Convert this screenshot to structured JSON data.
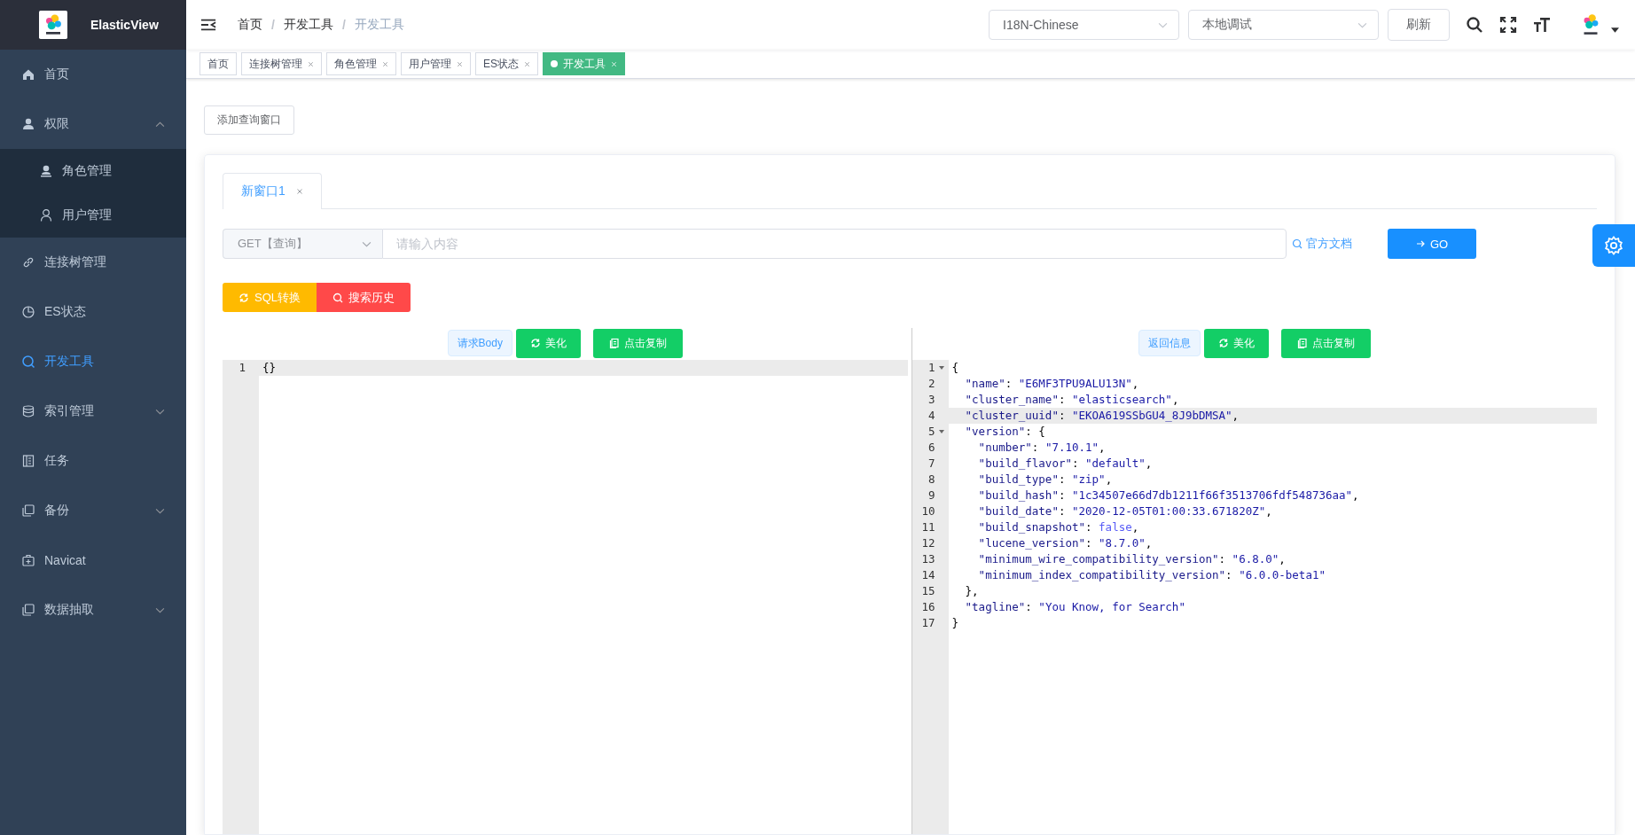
{
  "app": {
    "title": "ElasticView"
  },
  "sidebar": {
    "items": [
      {
        "label": "首页",
        "selected": false
      },
      {
        "label": "权限",
        "selected": false,
        "expanded": true,
        "children": [
          {
            "label": "角色管理",
            "selected": false
          },
          {
            "label": "用户管理",
            "selected": false
          }
        ]
      },
      {
        "label": "连接树管理",
        "selected": false
      },
      {
        "label": "ES状态",
        "selected": false
      },
      {
        "label": "开发工具",
        "selected": true
      },
      {
        "label": "索引管理",
        "selected": false,
        "expanded": false
      },
      {
        "label": "任务",
        "selected": false
      },
      {
        "label": "备份",
        "selected": false,
        "expanded": false
      },
      {
        "label": "Navicat",
        "selected": false
      },
      {
        "label": "数据抽取",
        "selected": false,
        "expanded": false
      }
    ]
  },
  "breadcrumb": [
    {
      "label": "首页"
    },
    {
      "separator": "/",
      "label": "开发工具"
    },
    {
      "separator": "/",
      "label": "开发工具"
    }
  ],
  "header": {
    "language": "I18N-Chinese",
    "connection": "本地调试",
    "refresh_button": "刷新"
  },
  "tags": [
    {
      "label": "首页",
      "selected": false,
      "closable": false
    },
    {
      "label": "连接树管理",
      "selected": false,
      "closable": true
    },
    {
      "label": "角色管理",
      "selected": false,
      "closable": true
    },
    {
      "label": "用户管理",
      "selected": false,
      "closable": true
    },
    {
      "label": "ES状态",
      "selected": false,
      "closable": true
    },
    {
      "label": "开发工具",
      "selected": true,
      "closable": true
    }
  ],
  "add_window_button": "添加查询窗口",
  "query_tabs": [
    {
      "label": "新窗口1",
      "selected": true
    }
  ],
  "query": {
    "method": "GET【查询】",
    "placeholder": "请输入内容",
    "docs_link": "官方文档",
    "go_button": "GO"
  },
  "actions": [
    {
      "label": "SQL转换",
      "kind": "warning"
    },
    {
      "label": "搜索历史",
      "kind": "danger"
    }
  ],
  "request_panel": {
    "tag": "请求Body",
    "format_button": "美化",
    "copy_button": "点击复制",
    "lines": [
      {
        "number": "1",
        "text": "{}",
        "active": true,
        "foldable": false
      }
    ]
  },
  "response_panel": {
    "tag": "返回信息",
    "format_button": "美化",
    "copy_button": "点击复制",
    "lines": [
      {
        "number": "1",
        "text": "{",
        "active": false,
        "foldable": true
      },
      {
        "number": "2",
        "text": "  \"name\": \"E6MF3TPU9ALU13N\",",
        "active": false,
        "foldable": false
      },
      {
        "number": "3",
        "text": "  \"cluster_name\": \"elasticsearch\",",
        "active": false,
        "foldable": false
      },
      {
        "number": "4",
        "text": "  \"cluster_uuid\": \"EKOA619SSbGU4_8J9bDMSA\",",
        "active": true,
        "foldable": false
      },
      {
        "number": "5",
        "text": "  \"version\": {",
        "active": false,
        "foldable": true
      },
      {
        "number": "6",
        "text": "    \"number\": \"7.10.1\",",
        "active": false,
        "foldable": false
      },
      {
        "number": "7",
        "text": "    \"build_flavor\": \"default\",",
        "active": false,
        "foldable": false
      },
      {
        "number": "8",
        "text": "    \"build_type\": \"zip\",",
        "active": false,
        "foldable": false
      },
      {
        "number": "9",
        "text": "    \"build_hash\": \"1c34507e66d7db1211f66f3513706fdf548736aa\",",
        "active": false,
        "foldable": false
      },
      {
        "number": "10",
        "text": "    \"build_date\": \"2020-12-05T01:00:33.671820Z\",",
        "active": false,
        "foldable": false
      },
      {
        "number": "11",
        "text": "    \"build_snapshot\": false,",
        "active": false,
        "foldable": false
      },
      {
        "number": "12",
        "text": "    \"lucene_version\": \"8.7.0\",",
        "active": false,
        "foldable": false
      },
      {
        "number": "13",
        "text": "    \"minimum_wire_compatibility_version\": \"6.8.0\",",
        "active": false,
        "foldable": false
      },
      {
        "number": "14",
        "text": "    \"minimum_index_compatibility_version\": \"6.0.0-beta1\"",
        "active": false,
        "foldable": false
      },
      {
        "number": "15",
        "text": "  },",
        "active": false,
        "foldable": false
      },
      {
        "number": "16",
        "text": "  \"tagline\": \"You Know, for Search\"",
        "active": false,
        "foldable": false
      },
      {
        "number": "17",
        "text": "}",
        "active": false,
        "foldable": false
      }
    ]
  }
}
